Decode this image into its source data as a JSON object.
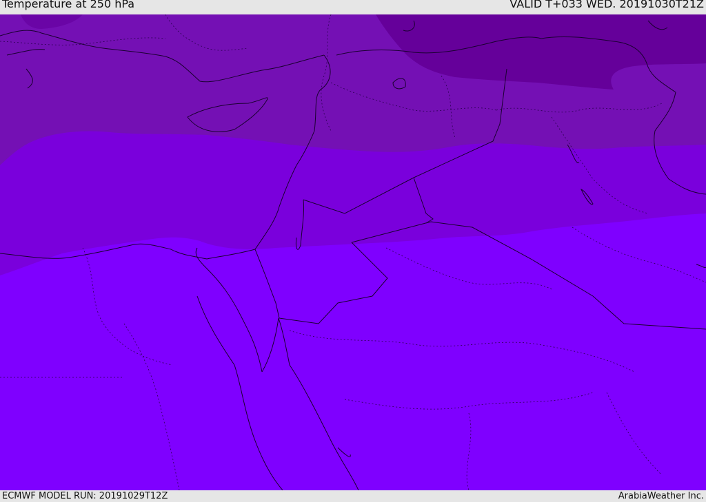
{
  "header": {
    "title": "Temperature at 250 hPa",
    "valid_time": "VALID T+033 WED. 20191030T21Z"
  },
  "footer": {
    "model_run": "ECMWF MODEL RUN: 20191029T12Z",
    "credit": "ArabiaWeather Inc."
  },
  "colors": {
    "band_coldest": "#65009a",
    "band_cold": "#7410b4",
    "band_mid": "#7a00dc",
    "band_warm": "#7f00ff",
    "coastline": "#1a0030",
    "border": "#2a0050",
    "header_bg": "#e6e6e6",
    "text": "#111111"
  }
}
